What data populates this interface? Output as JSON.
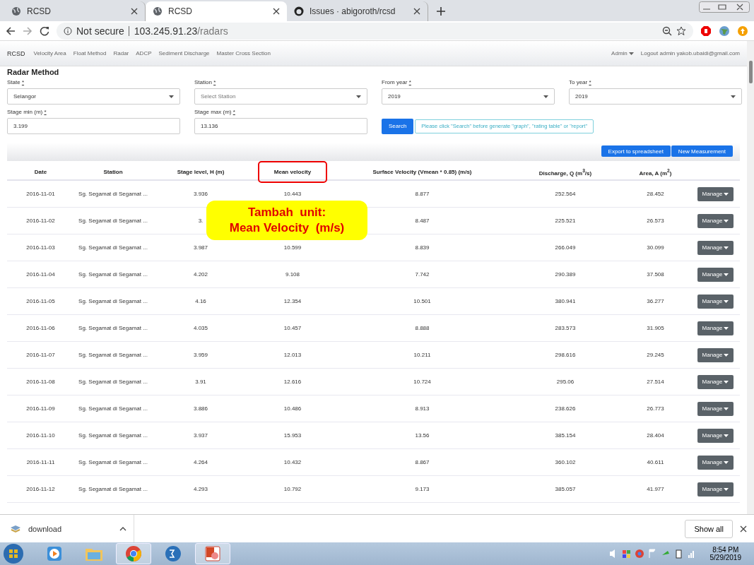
{
  "browser": {
    "tabs": [
      {
        "title": "RCSD",
        "selected": false
      },
      {
        "title": "RCSD",
        "selected": true
      },
      {
        "title": "Issues · abigoroth/rcsd",
        "selected": false
      }
    ],
    "security": "Not secure",
    "url_host": "103.245.91.23",
    "url_path": "/radars"
  },
  "navbar": {
    "brand": "RCSD",
    "items": [
      "Velocity Area",
      "Float Method",
      "Radar",
      "ADCP",
      "Sediment Discharge",
      "Master Cross Section"
    ],
    "user_menu": "Admin",
    "logout": "Logout admin yakob.ubaidi@gmail.com"
  },
  "page_title": "Radar Method",
  "filters": [
    {
      "kind": "select",
      "label": "State",
      "required": "*",
      "value": "Selangor",
      "placeholder_shown": false
    },
    {
      "kind": "select",
      "label": "Station",
      "required": "*",
      "value": "Select Station",
      "placeholder_shown": true
    },
    {
      "kind": "select",
      "label": "From year",
      "required": "*",
      "value": "2019",
      "placeholder_shown": false
    },
    {
      "kind": "select",
      "label": "To year",
      "required": "*",
      "value": "2019",
      "placeholder_shown": false
    },
    {
      "kind": "input",
      "label": "Stage min (m)",
      "required": "*",
      "value": "3.199"
    },
    {
      "kind": "input",
      "label": "Stage max (m)",
      "required": "*",
      "value": "13.136"
    }
  ],
  "search_button": "Search",
  "search_hint": "Please click \"Search\" before generate \"graph\", \"rating table\" or \"report\"",
  "toolbar_buttons": [
    "Export to spreadsheet",
    "New Measurement"
  ],
  "table": {
    "columns": [
      {
        "label": "Date",
        "highlighted": false
      },
      {
        "label": "Station",
        "highlighted": false
      },
      {
        "label": "Stage level, H (m)",
        "highlighted": false
      },
      {
        "label": "Mean velocity",
        "highlighted": true
      },
      {
        "label": "Surface Velocity (Vmean * 0.85) (m/s)",
        "highlighted": false
      },
      {
        "label": "Discharge, Q (m$^{3}$/s)",
        "highlighted": false
      },
      {
        "label": "Area, A (m$^{2}$)",
        "highlighted": false
      }
    ],
    "rows": [
      {
        "date": "2016-11-01",
        "station": "Sg. Segamat di Segamat ...",
        "stage": "3.936",
        "mean_velocity": "10.443",
        "surface_velocity": "8.877",
        "discharge": "252.564",
        "area": "28.452",
        "action": "Manage"
      },
      {
        "date": "2016-11-02",
        "station": "Sg. Segamat di Segamat ...",
        "stage": "3.",
        "surface_velocity": "8.487",
        "discharge": "225.521",
        "area": "26.573",
        "action": "Manage"
      },
      {
        "date": "2016-11-03",
        "station": "Sg. Segamat di Segamat ...",
        "stage": "3.987",
        "mean_velocity": "10.599",
        "surface_velocity": "8.839",
        "discharge": "266.049",
        "area": "30.099",
        "action": "Manage"
      },
      {
        "date": "2016-11-04",
        "station": "Sg. Segamat di Segamat ...",
        "stage": "4.202",
        "mean_velocity": "9.108",
        "surface_velocity": "7.742",
        "discharge": "290.389",
        "area": "37.508",
        "action": "Manage"
      },
      {
        "date": "2016-11-05",
        "station": "Sg. Segamat di Segamat ...",
        "stage": "4.16",
        "mean_velocity": "12.354",
        "surface_velocity": "10.501",
        "discharge": "380.941",
        "area": "36.277",
        "action": "Manage"
      },
      {
        "date": "2016-11-06",
        "station": "Sg. Segamat di Segamat ...",
        "stage": "4.035",
        "mean_velocity": "10.457",
        "surface_velocity": "8.888",
        "discharge": "283.573",
        "area": "31.905",
        "action": "Manage"
      },
      {
        "date": "2016-11-07",
        "station": "Sg. Segamat di Segamat ...",
        "stage": "3.959",
        "mean_velocity": "12.013",
        "surface_velocity": "10.211",
        "discharge": "298.616",
        "area": "29.245",
        "action": "Manage"
      },
      {
        "date": "2016-11-08",
        "station": "Sg. Segamat di Segamat ...",
        "stage": "3.91",
        "mean_velocity": "12.616",
        "surface_velocity": "10.724",
        "discharge": "295.06",
        "area": "27.514",
        "action": "Manage"
      },
      {
        "date": "2016-11-09",
        "station": "Sg. Segamat di Segamat ...",
        "stage": "3.886",
        "mean_velocity": "10.486",
        "surface_velocity": "8.913",
        "discharge": "238.626",
        "area": "26.773",
        "action": "Manage"
      },
      {
        "date": "2016-11-10",
        "station": "Sg. Segamat di Segamat ...",
        "stage": "3.937",
        "mean_velocity": "15.953",
        "surface_velocity": "13.56",
        "discharge": "385.154",
        "area": "28.404",
        "action": "Manage"
      },
      {
        "date": "2016-11-11",
        "station": "Sg. Segamat di Segamat ...",
        "stage": "4.264",
        "mean_velocity": "10.432",
        "surface_velocity": "8.867",
        "discharge": "360.102",
        "area": "40.611",
        "action": "Manage"
      },
      {
        "date": "2016-11-12",
        "station": "Sg. Segamat di Segamat ...",
        "stage": "4.293",
        "mean_velocity": "10.792",
        "surface_velocity": "9.173",
        "discharge": "385.057",
        "area": "41.977",
        "action": "Manage"
      }
    ]
  },
  "annotation": {
    "lines": [
      "Tambah  unit:",
      "Mean Velocity  (m/s)"
    ]
  },
  "download_bar": {
    "file": "download",
    "show_all": "Show all"
  },
  "taskbar": {
    "time": "8:54 PM",
    "date": "5/29/2019"
  }
}
